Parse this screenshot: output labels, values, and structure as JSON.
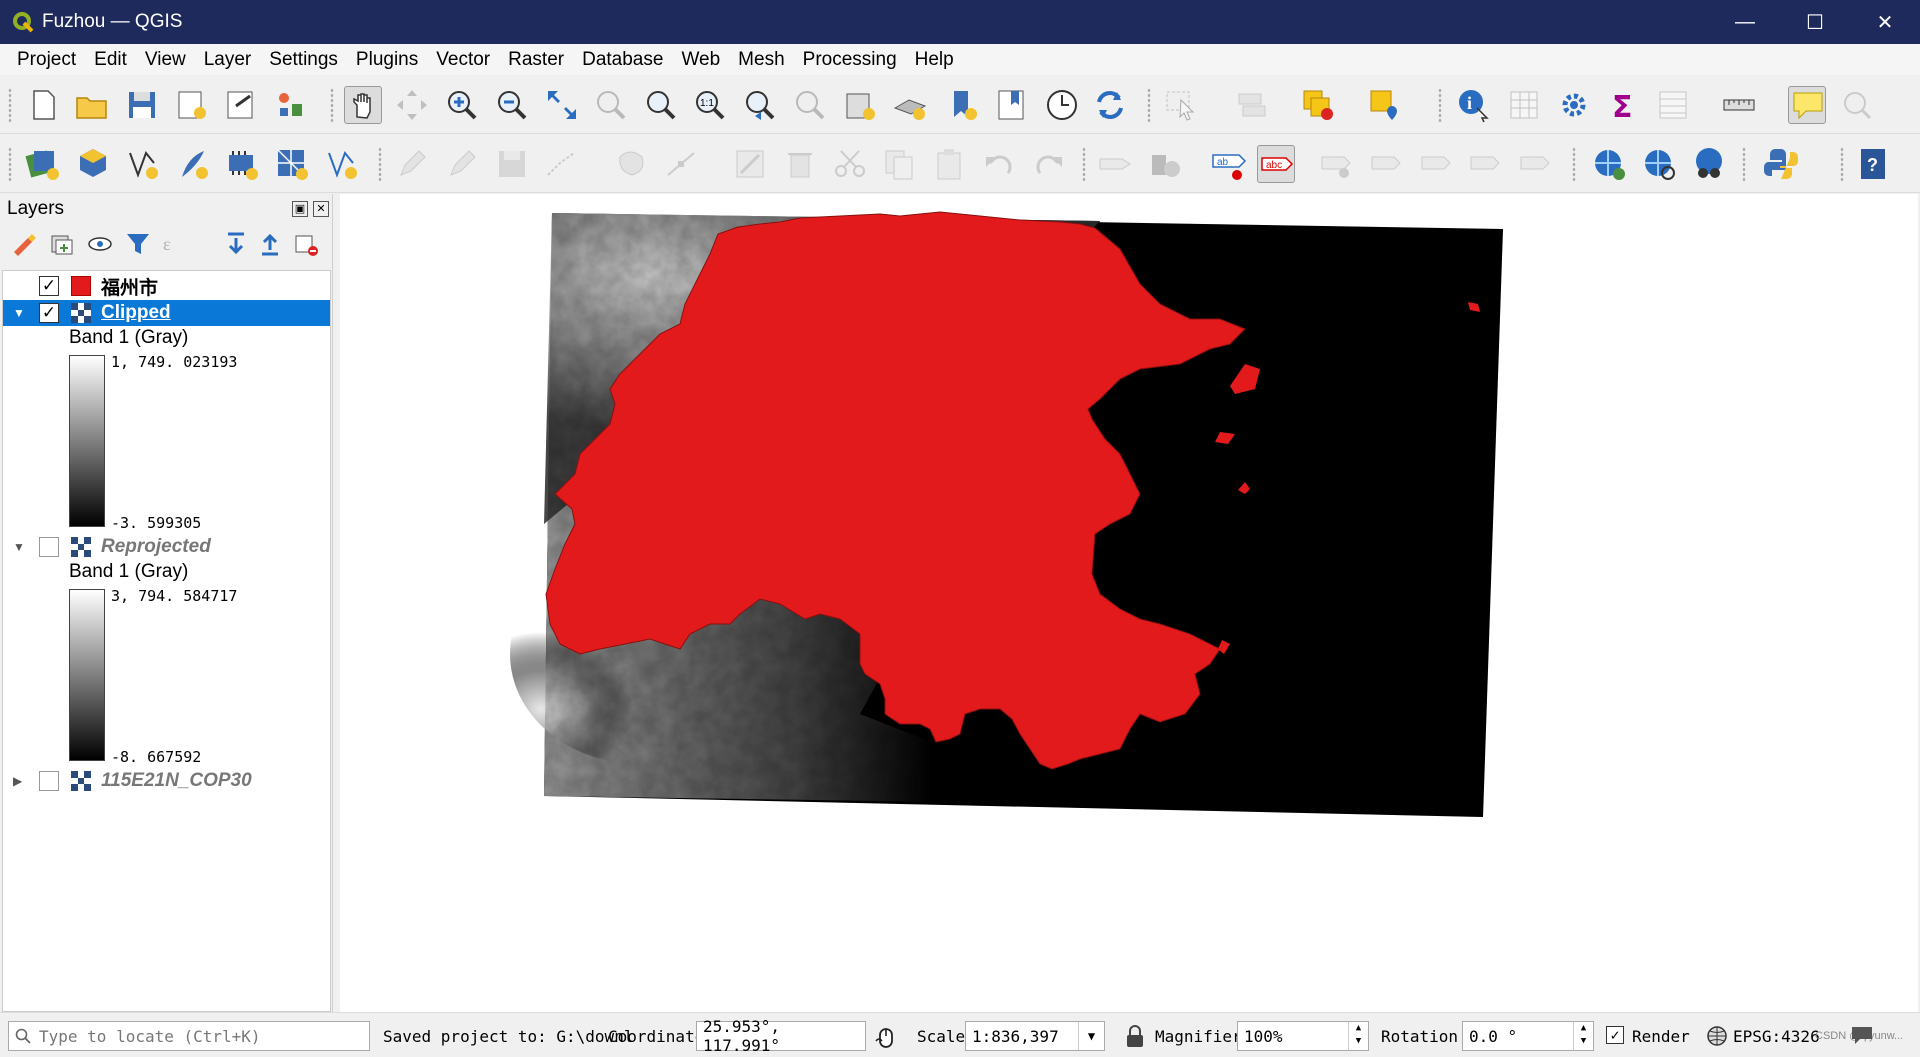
{
  "window": {
    "title": "Fuzhou — QGIS"
  },
  "menu": [
    "Project",
    "Edit",
    "View",
    "Layer",
    "Settings",
    "Plugins",
    "Vector",
    "Raster",
    "Database",
    "Web",
    "Mesh",
    "Processing",
    "Help"
  ],
  "layers_panel": {
    "title": "Layers",
    "layers": [
      {
        "name": "福州市",
        "checked": true,
        "type": "vector",
        "color": "#e31a1c"
      },
      {
        "name": "Clipped",
        "checked": true,
        "type": "raster",
        "band_label": "Band 1 (Gray)",
        "max": "1, 749. 023193",
        "min": "-3. 599305"
      },
      {
        "name": "Reprojected",
        "checked": false,
        "type": "raster",
        "band_label": "Band 1 (Gray)",
        "max": "3, 794. 584717",
        "min": "-8. 667592"
      },
      {
        "name": "115E21N_COP30",
        "checked": false,
        "type": "raster"
      }
    ]
  },
  "statusbar": {
    "locate_placeholder": "Type to locate (Ctrl+K)",
    "message": "Saved project to: G:\\downl",
    "coordinate_label": "Coordinate",
    "coordinate_value": "25.953°, 117.991°",
    "scale_label": "Scale",
    "scale_value": "1:836,397",
    "magnifier_label": "Magnifier",
    "magnifier_value": "100%",
    "rotation_label": "Rotation",
    "rotation_value": "0.0 °",
    "render_label": "Render",
    "render_checked": true,
    "crs": "EPSG:4326",
    "watermark": "CSDN @qiyunw..."
  },
  "colors": {
    "titlebar": "#1f2a5c",
    "selection": "#0a78d7",
    "polygon": "#e31a1c"
  }
}
